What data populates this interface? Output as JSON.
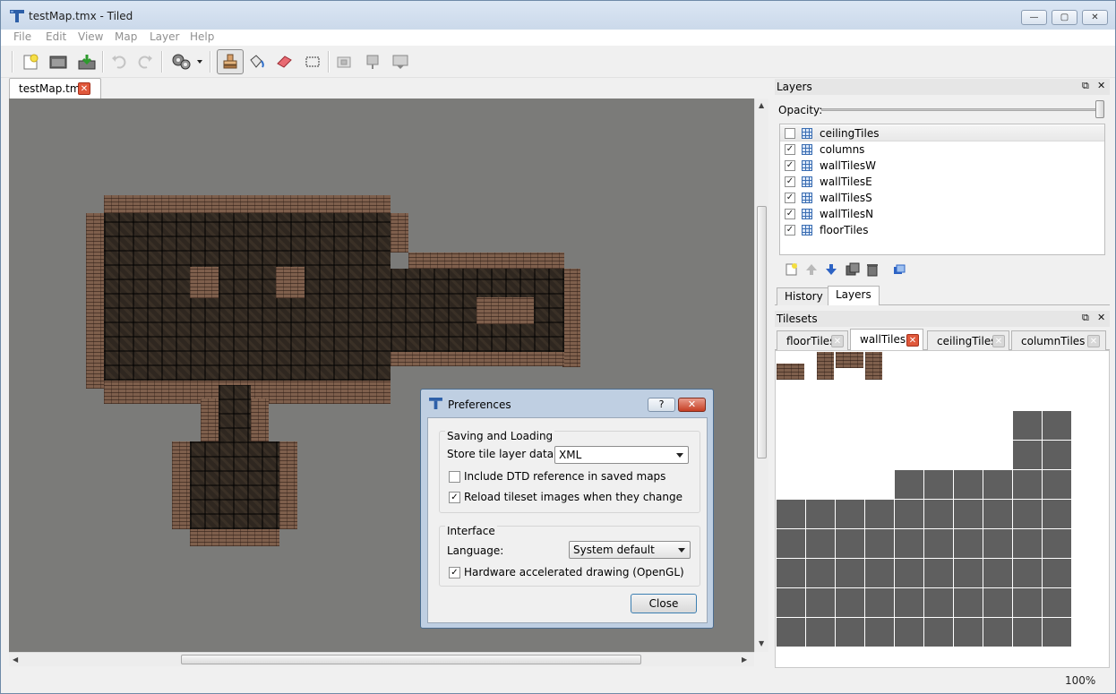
{
  "window": {
    "title": "testMap.tmx - Tiled",
    "controls": {
      "minimize": "—",
      "maximize": "▢",
      "close": "✕"
    }
  },
  "menu": [
    "File",
    "Edit",
    "View",
    "Map",
    "Layer",
    "Help"
  ],
  "toolbar": {
    "icons": [
      "new-map-icon",
      "open-icon",
      "save-icon",
      "undo-icon",
      "redo-icon",
      "commands-icon",
      "stamp-brush-icon",
      "bucket-fill-icon",
      "eraser-icon",
      "rectangle-select-icon",
      "map-object-icon",
      "insert-object-icon",
      "insert-tile-icon"
    ],
    "active_tool": "stamp-brush-icon"
  },
  "document_tab": {
    "label": "testMap.tmx",
    "close": "✕"
  },
  "status": {
    "zoom": "100%"
  },
  "layers_panel": {
    "title": "Layers",
    "float": "⧉",
    "close": "✕",
    "opacity_label": "Opacity:",
    "opacity_value": 1.0,
    "layers": [
      {
        "name": "ceilingTiles",
        "visible": false,
        "selected": true
      },
      {
        "name": "columns",
        "visible": true,
        "selected": false
      },
      {
        "name": "wallTilesW",
        "visible": true,
        "selected": false
      },
      {
        "name": "wallTilesE",
        "visible": true,
        "selected": false
      },
      {
        "name": "wallTilesS",
        "visible": true,
        "selected": false
      },
      {
        "name": "wallTilesN",
        "visible": true,
        "selected": false
      },
      {
        "name": "floorTiles",
        "visible": true,
        "selected": false
      }
    ],
    "tools": [
      "add-layer-icon",
      "raise-layer-icon",
      "lower-layer-icon",
      "duplicate-layer-icon",
      "remove-layer-icon",
      "layer-properties-icon"
    ],
    "tabs": [
      {
        "label": "History",
        "active": false
      },
      {
        "label": "Layers",
        "active": true
      }
    ]
  },
  "tilesets_panel": {
    "title": "Tilesets",
    "float": "⧉",
    "close": "✕",
    "tabs": [
      {
        "label": "floorTiles",
        "active": false
      },
      {
        "label": "wallTiles",
        "active": true
      },
      {
        "label": "ceilingTiles",
        "active": false
      },
      {
        "label": "columnTiles",
        "active": false
      }
    ]
  },
  "preferences": {
    "title": "Preferences",
    "help": "?",
    "close_x": "✕",
    "saving_group": "Saving and Loading",
    "store_label": "Store tile layer data as:",
    "store_value": "XML",
    "dtd_label": "Include DTD reference in saved maps",
    "dtd_checked": false,
    "reload_label": "Reload tileset images when they change",
    "reload_checked": true,
    "interface_group": "Interface",
    "language_label": "Language:",
    "language_value": "System default",
    "hw_label": "Hardware accelerated drawing (OpenGL)",
    "hw_checked": true,
    "close_button": "Close"
  },
  "colors": {
    "canvas": "#7b7b79",
    "wall": "#7e5f4c",
    "floor": "#2f2720",
    "close_red": "#e0583b",
    "tile_grey": "#5f5f5f"
  }
}
